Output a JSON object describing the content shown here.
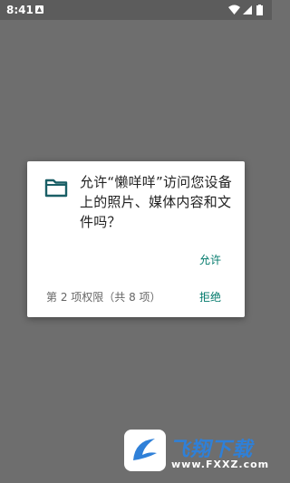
{
  "status_bar": {
    "time": "8:41",
    "icons": [
      "notification-icon",
      "wifi-icon",
      "signal-icon",
      "battery-icon"
    ]
  },
  "dialog": {
    "icon": "folder-icon",
    "message": "允许“懒咩咩”访问您设备上的照片、媒体内容和文件吗？",
    "allow_label": "允许",
    "permission_count": "第 2 项权限（共 8 项）",
    "deny_label": "拒绝"
  },
  "watermark": {
    "title": "飞翔下载",
    "url": "www.FXXZ.com"
  },
  "colors": {
    "accent": "#00796b",
    "scrim": "#6e6e6e",
    "status_bar": "#5c5c5c",
    "dialog_bg": "#ffffff",
    "folder_icon": "#1a5f66",
    "watermark_blue": "#2f80d8"
  }
}
